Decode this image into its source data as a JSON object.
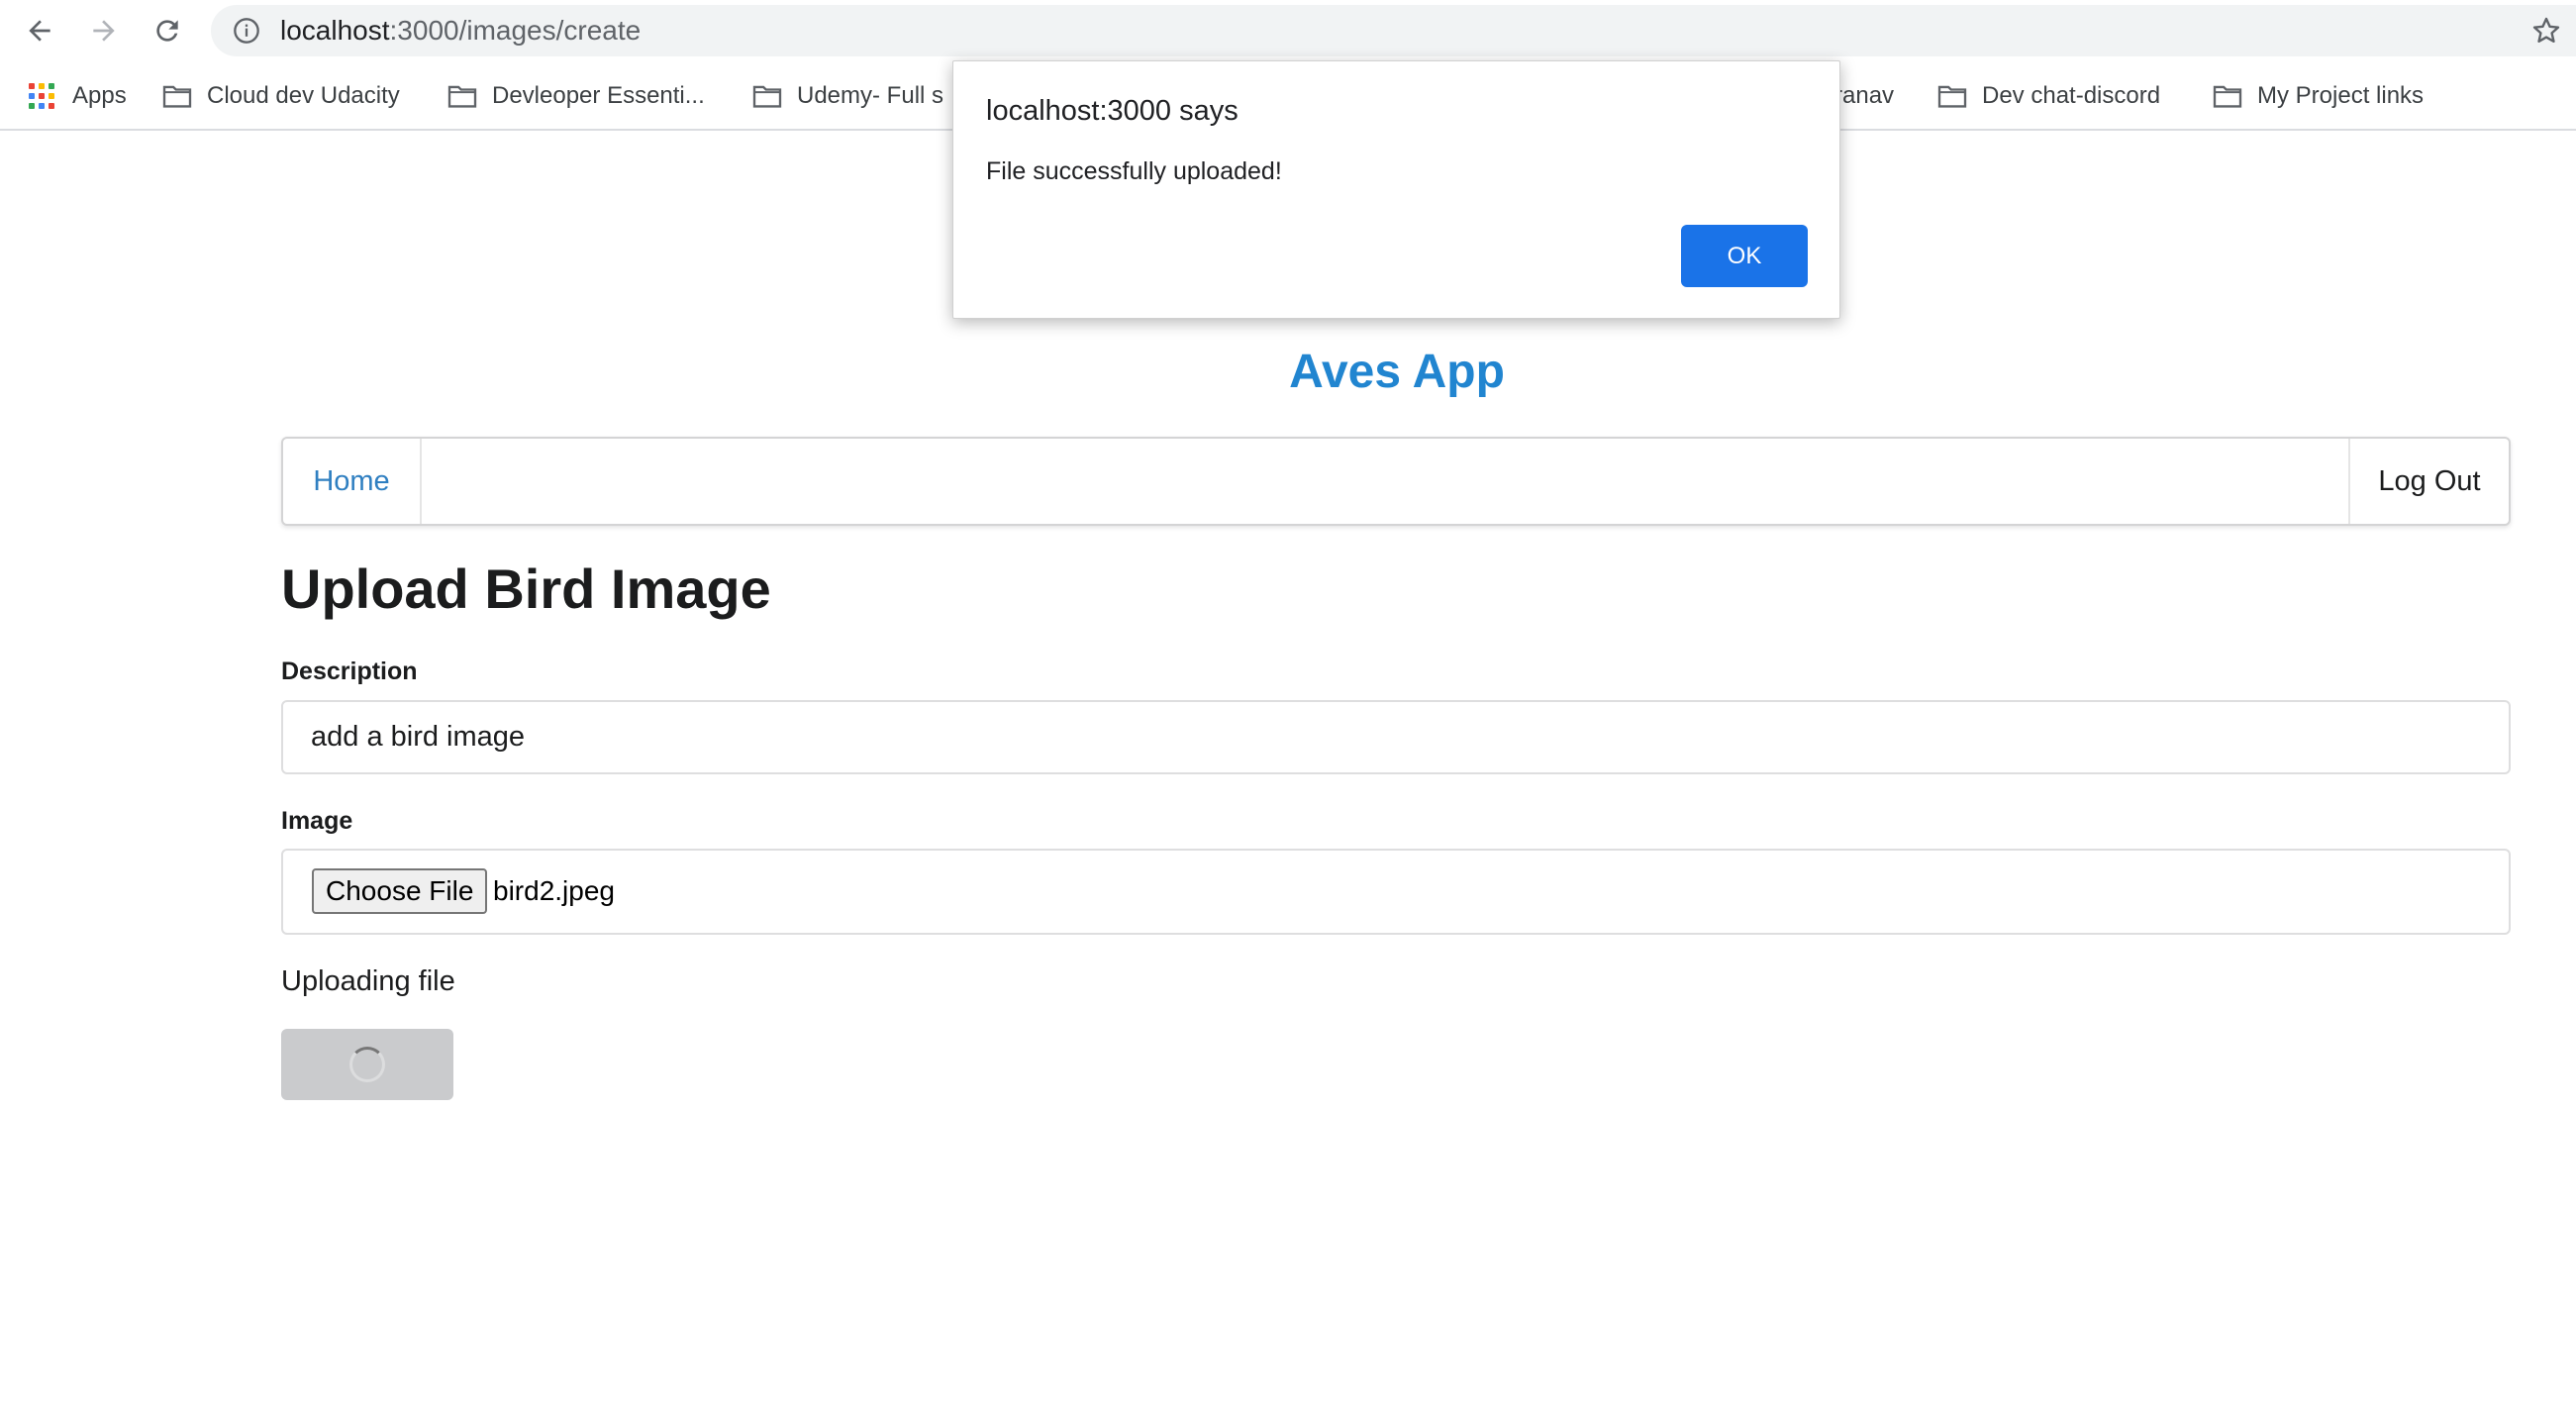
{
  "browser": {
    "url_host": "localhost",
    "url_path": ":3000/images/create",
    "bookmarks": [
      {
        "label": "Apps",
        "icon": "apps-grid-icon"
      },
      {
        "label": "Cloud dev Udacity",
        "icon": "folder-icon"
      },
      {
        "label": "Devleoper Essenti...",
        "icon": "folder-icon"
      },
      {
        "label": "Udemy- Full s",
        "icon": "folder-icon"
      },
      {
        "label": "ranav",
        "icon": "folder-icon"
      },
      {
        "label": "Dev chat-discord",
        "icon": "folder-icon"
      },
      {
        "label": "My Project links",
        "icon": "folder-icon"
      }
    ]
  },
  "app": {
    "title": "Aves App",
    "menu": {
      "home": "Home",
      "logout": "Log Out"
    }
  },
  "form": {
    "heading": "Upload Bird Image",
    "description_label": "Description",
    "description_value": "add a bird image",
    "image_label": "Image",
    "choose_file_label": "Choose File",
    "file_name": "bird2.jpeg",
    "status": "Uploading file"
  },
  "dialog": {
    "title": "localhost:3000 says",
    "message": "File successfully uploaded!",
    "ok_label": "OK"
  },
  "colors": {
    "accent": "#2185d0",
    "dialog_button": "#1a73e8",
    "loading_button": "#cacbcd"
  }
}
